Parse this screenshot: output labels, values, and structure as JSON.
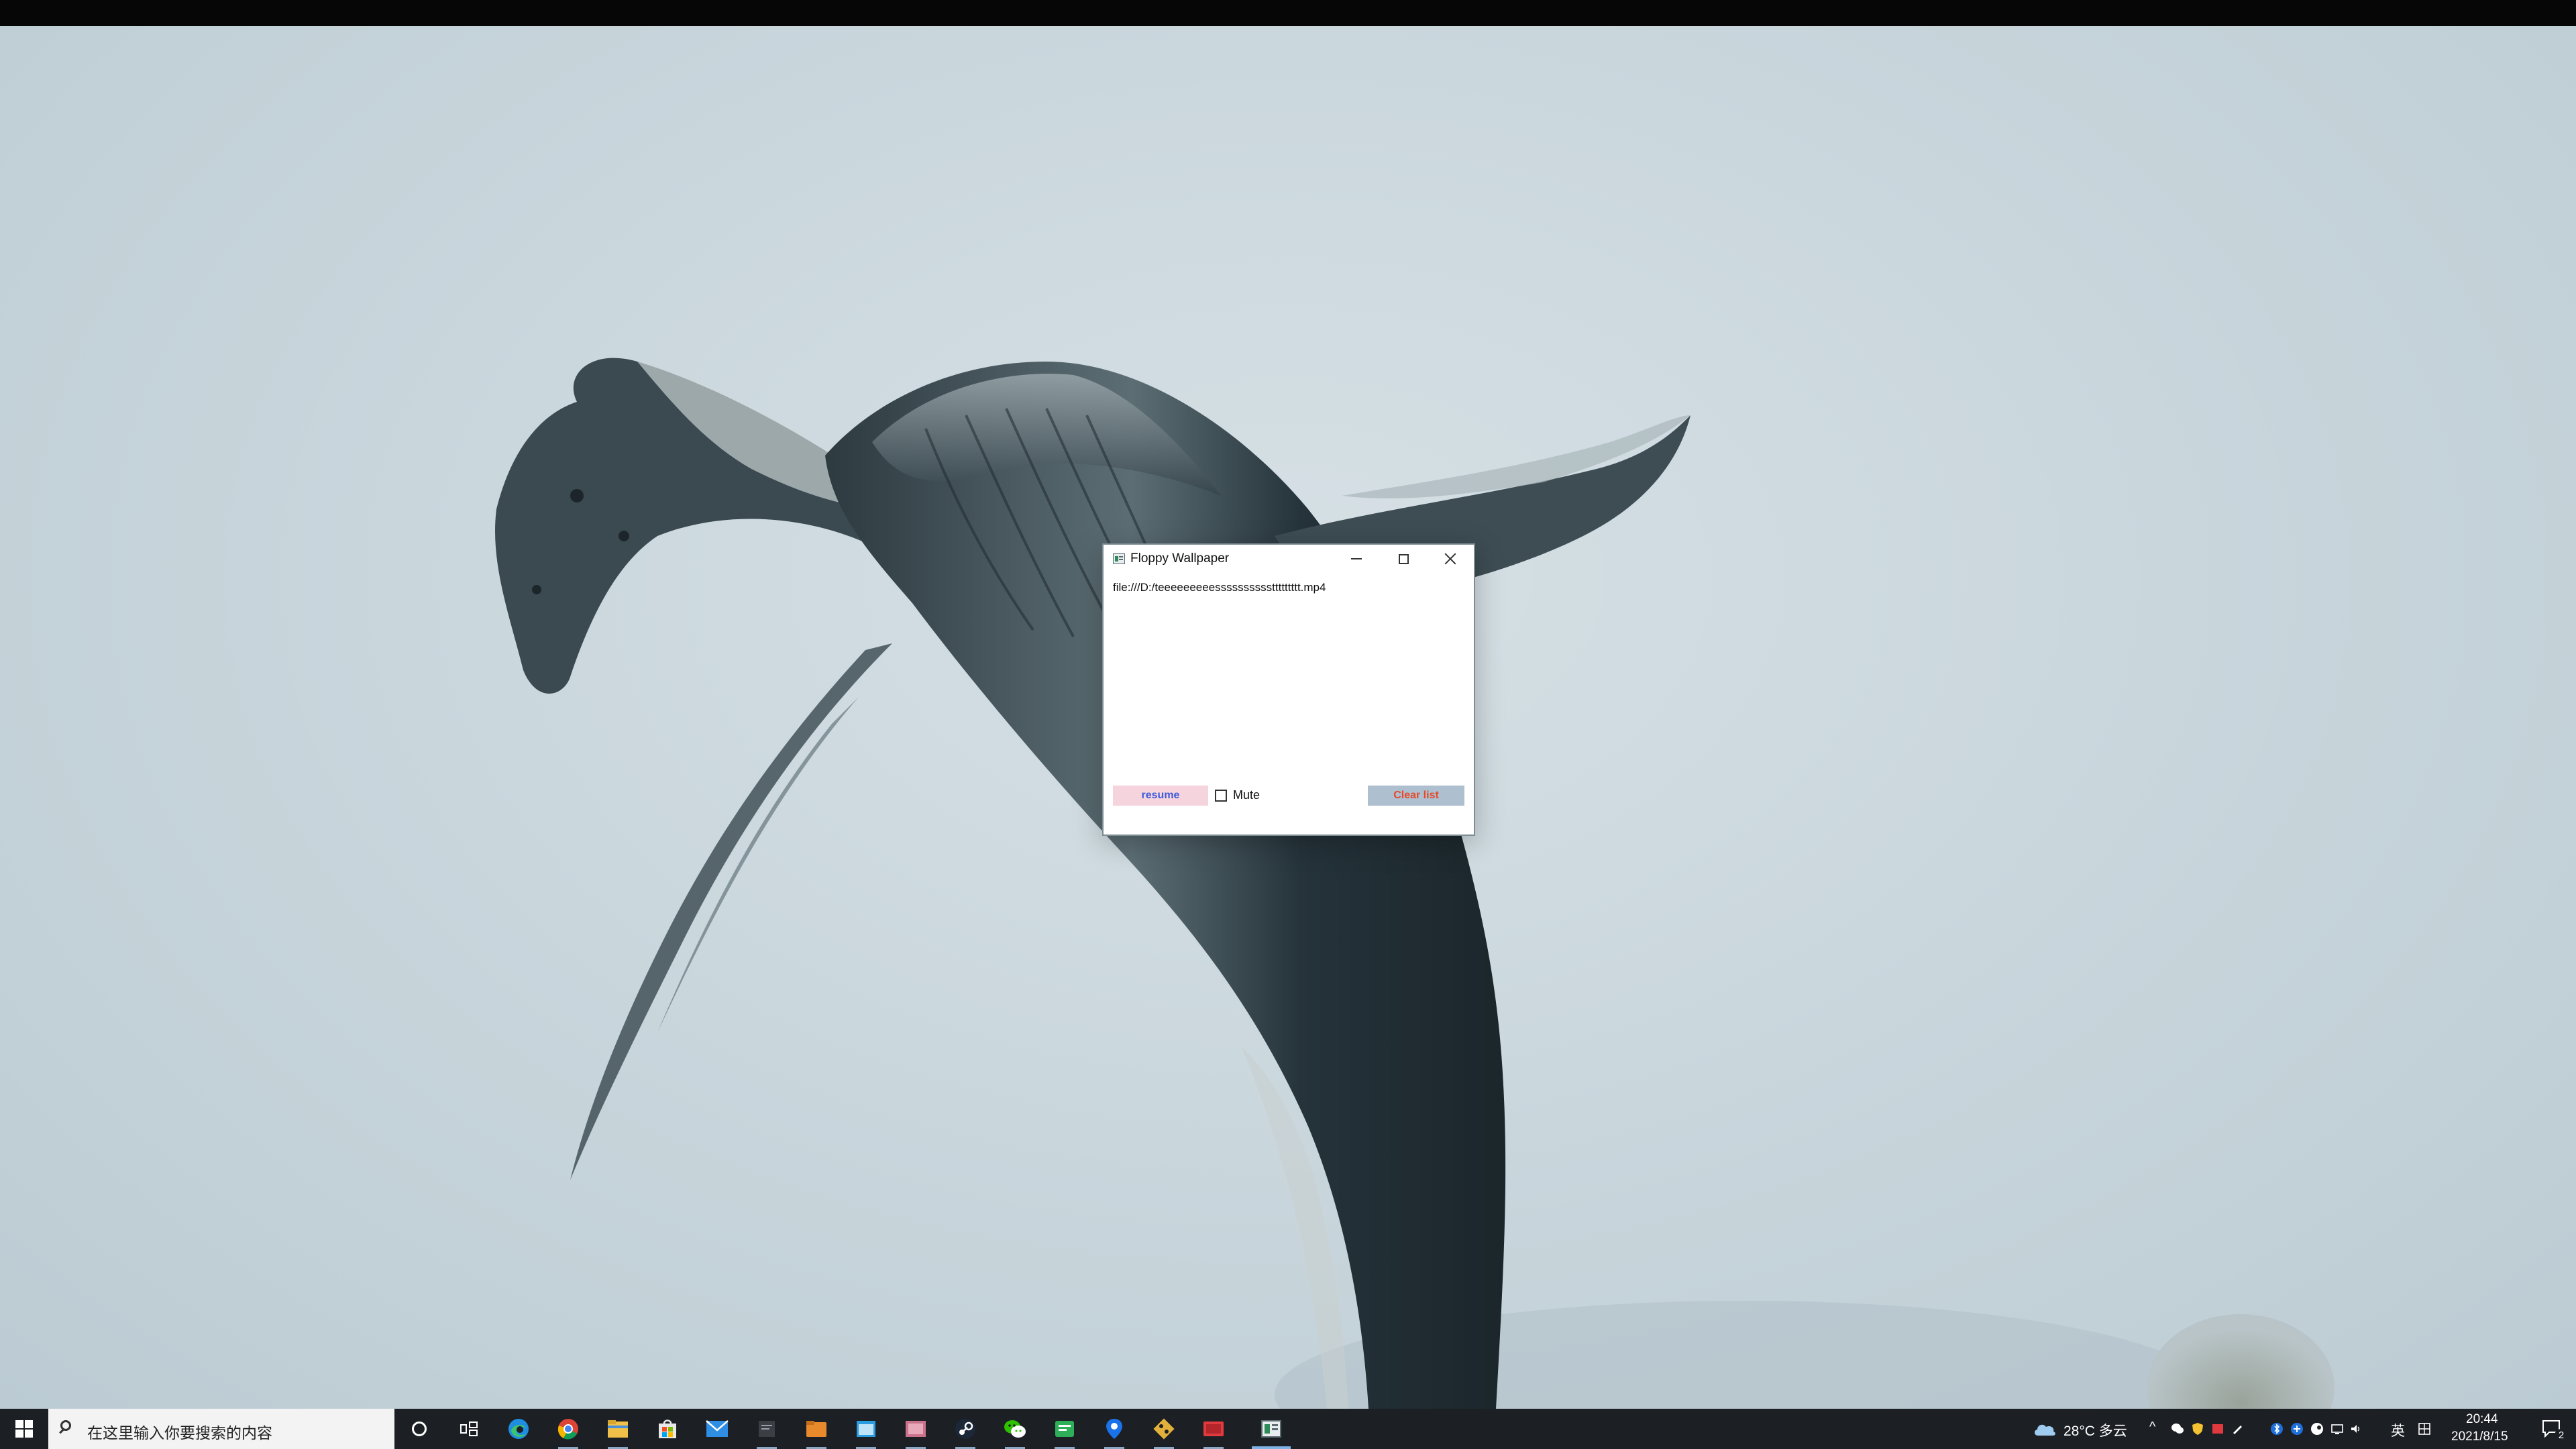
{
  "window": {
    "title": "Floppy Wallpaper",
    "file_list": [
      "file:///D:/teeeeeeeeessssssssssttttttttt.mp4"
    ],
    "controls": {
      "resume_label": "resume",
      "mute_label": "Mute",
      "mute_checked": false,
      "clear_label": "Clear list"
    }
  },
  "taskbar": {
    "search_placeholder": "在这里输入你要搜索的内容",
    "pinned_icons": [
      "cortana-icon",
      "task-view-icon",
      "edge-icon",
      "chrome-icon",
      "file-explorer-icon",
      "store-icon",
      "mail-icon",
      "app-icon-dark",
      "folder-orange-icon",
      "window-blue-icon",
      "pink-app-icon",
      "steam-icon",
      "wechat-icon",
      "green-app-icon",
      "maps-pin-icon",
      "git-icon",
      "red-app-icon",
      "floppy-wallpaper-icon"
    ],
    "weather": "28°C 多云",
    "ime_label": "英",
    "clock_time": "20:44",
    "clock_date": "2021/8/15",
    "notification_count": "2"
  },
  "colors": {
    "resume_bg": "#f6d4de",
    "resume_text": "#3d5cd9",
    "clear_bg": "#aebfd0",
    "clear_text": "#e44a2a",
    "taskbar_bg": "#1c1f24"
  }
}
